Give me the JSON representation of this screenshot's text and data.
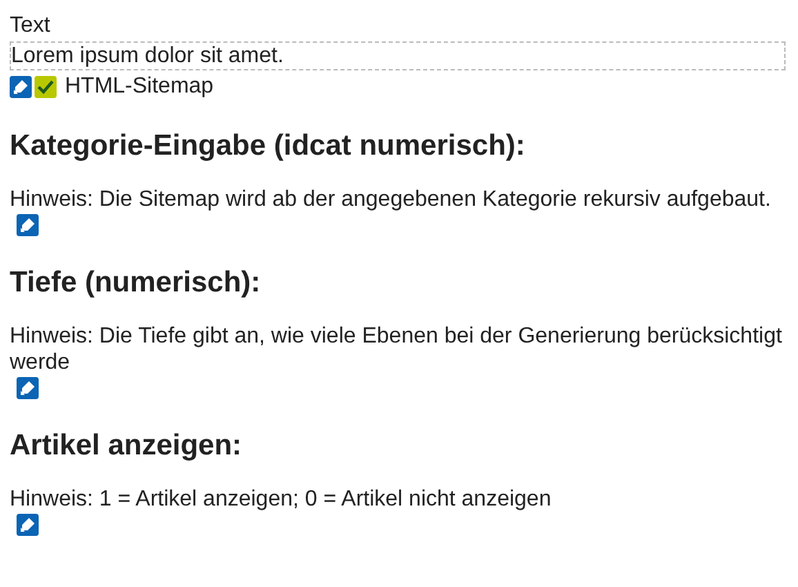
{
  "label": "Text",
  "text_value": "Lorem ipsum dolor sit amet.",
  "module": {
    "name": "HTML-Sitemap"
  },
  "sections": [
    {
      "heading": "Kategorie-Eingabe (idcat numerisch):",
      "hint": "Hinweis: Die Sitemap wird ab der angegebenen Kategorie rekursiv aufgebaut."
    },
    {
      "heading": "Tiefe (numerisch):",
      "hint": "Hinweis: Die Tiefe gibt an, wie viele Ebenen bei der Generierung berücksichtigt werde"
    },
    {
      "heading": "Artikel anzeigen:",
      "hint": "Hinweis: 1 = Artikel anzeigen; 0 = Artikel nicht anzeigen"
    }
  ]
}
